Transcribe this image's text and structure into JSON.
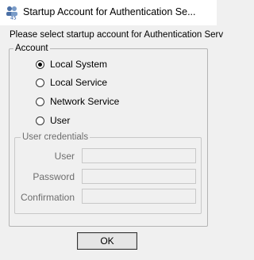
{
  "window": {
    "title": "Startup Account for Authentication Se..."
  },
  "dialog": {
    "prompt": "Please select startup account for Authentication Serv",
    "account_group": {
      "legend": "Account",
      "options": [
        {
          "label": "Local System",
          "checked": true
        },
        {
          "label": "Local Service",
          "checked": false
        },
        {
          "label": "Network Service",
          "checked": false
        },
        {
          "label": "User",
          "checked": false
        }
      ]
    },
    "credentials_group": {
      "legend": "User credentials",
      "fields": [
        {
          "label": "User",
          "value": ""
        },
        {
          "label": "Password",
          "value": ""
        },
        {
          "label": "Confirmation",
          "value": ""
        }
      ]
    },
    "ok_label": "OK"
  }
}
